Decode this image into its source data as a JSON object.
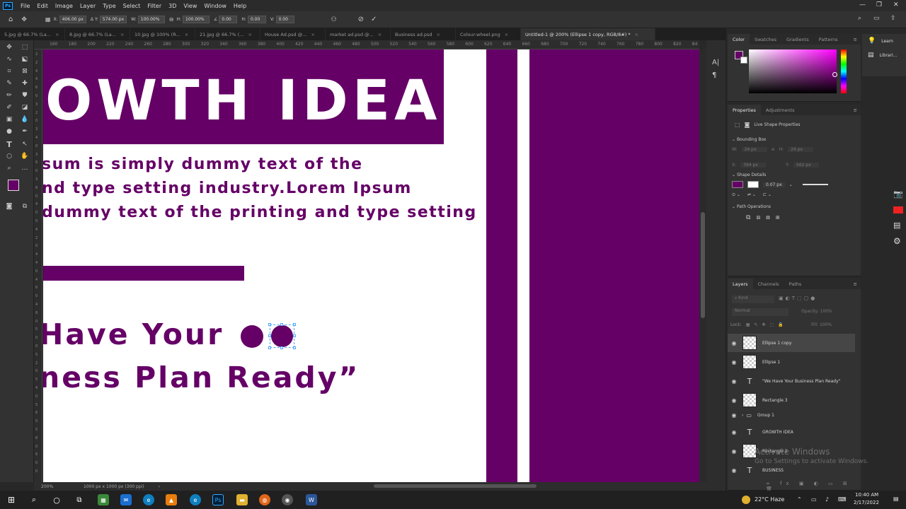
{
  "menu": {
    "logo": "Ps",
    "items": [
      "File",
      "Edit",
      "Image",
      "Layer",
      "Type",
      "Select",
      "Filter",
      "3D",
      "View",
      "Window",
      "Help"
    ]
  },
  "options": {
    "x_label": "X:",
    "x_value": "406.00 px",
    "y_label": "Y:",
    "y_value": "574.00 px",
    "w_label": "W:",
    "w_value": "100.00%",
    "h_label": "H:",
    "h_value": "100.00%",
    "angle_value": "0.00",
    "hskew_label": "H:",
    "hskew_value": "0.00",
    "vskew_label": "V:",
    "vskew_value": "0.00"
  },
  "tabs": [
    {
      "label": "5.jpg @ 66.7% (La...",
      "active": false
    },
    {
      "label": "8.jpg @ 66.7% (La...",
      "active": false
    },
    {
      "label": "10.jpg @ 100% (R...",
      "active": false
    },
    {
      "label": "21.jpg @ 66.7% (...",
      "active": false
    },
    {
      "label": "House Ad.psd @...",
      "active": false
    },
    {
      "label": "market ad.psd @...",
      "active": false
    },
    {
      "label": "Business ad.psd",
      "active": false
    },
    {
      "label": "Colour-wheel.png",
      "active": false
    },
    {
      "label": "Untitled-1 @ 200% (Ellipse 1 copy, RGB/8#) *",
      "active": true
    }
  ],
  "ruler_h_ticks": [
    "160",
    "180",
    "200",
    "220",
    "240",
    "260",
    "280",
    "300",
    "320",
    "340",
    "360",
    "380",
    "400",
    "420",
    "440",
    "460",
    "480",
    "500",
    "520",
    "540",
    "560",
    "580",
    "600",
    "620",
    "640",
    "660",
    "680",
    "700",
    "720",
    "740",
    "760",
    "780",
    "800",
    "820",
    "84"
  ],
  "ruler_v_ticks": [
    "2",
    "2",
    "4",
    "4",
    "6",
    "0",
    "3",
    "2",
    "0",
    "3",
    "4",
    "0",
    "3",
    "6",
    "0",
    "3",
    "8",
    "0",
    "4",
    "0",
    "0",
    "4",
    "2",
    "0",
    "4",
    "4",
    "0",
    "4",
    "6",
    "0",
    "4",
    "8",
    "0",
    "5",
    "0",
    "0",
    "5",
    "2",
    "0",
    "5",
    "4",
    "0",
    "5",
    "6",
    "0",
    "5",
    "8",
    "0",
    "6",
    "0",
    "0"
  ],
  "canvas": {
    "headline": "OWTH IDEA",
    "body_lines": [
      "sum is simply dummy text of the",
      "nd type setting industry.Lorem Ipsum",
      "dummy text of the printing and type setting"
    ],
    "quote_lines": [
      "Have Your",
      "ness Plan Ready”"
    ],
    "accent_color": "#650066"
  },
  "status": {
    "zoom": "200%",
    "doc_info": "1000 px x 1000 px (300 ppi)"
  },
  "color_panel": {
    "tabs": [
      "Color",
      "Swatches",
      "Gradients",
      "Patterns"
    ],
    "foreground": "#650066",
    "background": "#ffffff"
  },
  "learn_panel": {
    "items": [
      "Learn",
      "Librari..."
    ]
  },
  "properties_panel": {
    "tabs": [
      "Properties",
      "Adjustments"
    ],
    "title": "Live Shape Properties",
    "sections": [
      "Bounding Box",
      "Shape Details",
      "Path Operations"
    ],
    "w_label": "W:",
    "w_value": "24 px",
    "h_label": "H:",
    "h_value": "24 px",
    "x_label": "X:",
    "x_value": "394 px",
    "y_label": "Y:",
    "y_value": "562 px",
    "stroke_width": "0.07 px"
  },
  "layers_panel": {
    "tabs": [
      "Layers",
      "Channels",
      "Paths"
    ],
    "search_placeholder": "Kind",
    "blend_mode": "Normal",
    "opacity_label": "Opacity:",
    "opacity_value": "100%",
    "lock_label": "Lock:",
    "fill_label": "Fill:",
    "fill_value": "100%",
    "layers": [
      {
        "name": "Ellipse 1 copy",
        "kind": "shape",
        "selected": true
      },
      {
        "name": "Ellipse 1",
        "kind": "shape",
        "selected": false
      },
      {
        "name": "\"We Have Your  Business Plan Ready\"",
        "kind": "text",
        "selected": false
      },
      {
        "name": "Rectangle 3",
        "kind": "shape",
        "selected": false
      },
      {
        "name": "Group 1",
        "kind": "group",
        "selected": false
      },
      {
        "name": "GROWTH IDEA",
        "kind": "text",
        "selected": false
      },
      {
        "name": "Rectangle 2",
        "kind": "shape",
        "selected": false
      },
      {
        "name": "BUSINESS",
        "kind": "text",
        "selected": false
      }
    ]
  },
  "watermark": {
    "line1": "Activate Windows",
    "line2": "Go to Settings to activate Windows."
  },
  "taskbar": {
    "weather": "22°C  Haze",
    "time": "10:40 AM",
    "date": "2/17/2022"
  }
}
